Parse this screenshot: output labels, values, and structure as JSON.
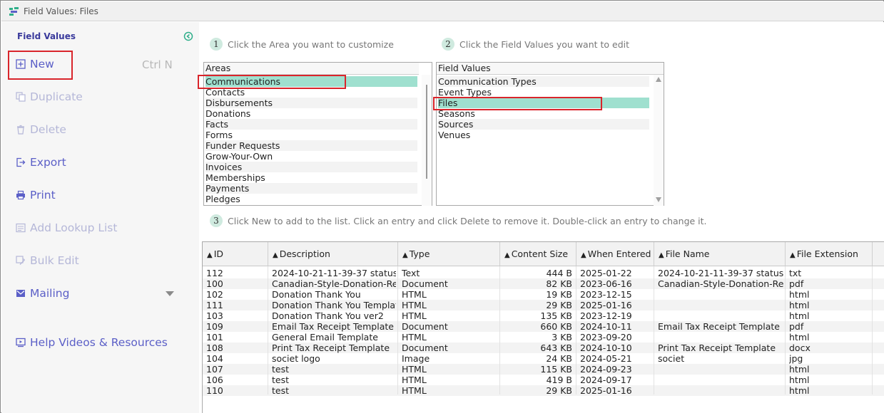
{
  "window": {
    "title": "Field Values: Files"
  },
  "sidebar": {
    "title": "Field Values",
    "new": {
      "label": "New",
      "shortcut": "Ctrl N"
    },
    "items": [
      {
        "label": "Duplicate",
        "enabled": false
      },
      {
        "label": "Delete",
        "enabled": false
      },
      {
        "label": "Export",
        "enabled": true
      },
      {
        "label": "Print",
        "enabled": true
      },
      {
        "label": "Add Lookup List",
        "enabled": false
      },
      {
        "label": "Bulk Edit",
        "enabled": false
      },
      {
        "label": "Mailing",
        "enabled": true
      }
    ],
    "help": {
      "label": "Help Videos & Resources"
    }
  },
  "steps": {
    "s1": {
      "num": "1",
      "text": "Click the Area you want to customize"
    },
    "s2": {
      "num": "2",
      "text": "Click the Field Values you want to edit"
    },
    "s3": {
      "num": "3",
      "text": "Click New to add to the list. Click an entry and click Delete to remove it. Double-click an entry to change it."
    }
  },
  "areas": {
    "header": "Areas",
    "selected": "Communications",
    "items": [
      "Communications",
      "Contacts",
      "Disbursements",
      "Donations",
      "Facts",
      "Forms",
      "Funder Requests",
      "Grow-Your-Own",
      "Invoices",
      "Memberships",
      "Payments",
      "Pledges"
    ]
  },
  "field_values": {
    "header": "Field Values",
    "selected": "Files",
    "items": [
      "Communication Types",
      "Event Types",
      "Files",
      "Seasons",
      "Sources",
      "Venues"
    ]
  },
  "table": {
    "columns": [
      "ID",
      "Description",
      "Type",
      "Content Size",
      "When Entered",
      "File Name",
      "File Extension"
    ],
    "rows": [
      [
        "112",
        "2024-10-21-11-39-37 status",
        "Text",
        "444 B",
        "2025-01-22",
        "2024-10-21-11-39-37 status",
        "txt"
      ],
      [
        "100",
        "Canadian-Style-Donation-Rec",
        "Document",
        "82 KB",
        "2023-06-16",
        "Canadian-Style-Donation-Rec",
        "pdf"
      ],
      [
        "102",
        "Donation Thank You",
        "HTML",
        "19 KB",
        "2023-12-15",
        "",
        "html"
      ],
      [
        "111",
        "Donation Thank You Template",
        "HTML",
        "29 KB",
        "2025-01-16",
        "",
        "html"
      ],
      [
        "103",
        "Donation Thank You ver2",
        "HTML",
        "135 KB",
        "2023-12-19",
        "",
        "html"
      ],
      [
        "109",
        "Email Tax Receipt Template",
        "Document",
        "660 KB",
        "2024-10-11",
        "Email Tax Receipt Template",
        "pdf"
      ],
      [
        "101",
        "General Email Template",
        "HTML",
        "3 KB",
        "2023-09-20",
        "",
        "html"
      ],
      [
        "108",
        "Print Tax Receipt Template",
        "Document",
        "643 KB",
        "2024-10-10",
        "Print Tax Receipt Template",
        "docx"
      ],
      [
        "104",
        "societ logo",
        "Image",
        "24 KB",
        "2024-05-21",
        "societ",
        "jpg"
      ],
      [
        "107",
        "test",
        "HTML",
        "115 KB",
        "2024-09-23",
        "",
        "html"
      ],
      [
        "106",
        "test",
        "HTML",
        "419 B",
        "2024-09-17",
        "",
        "html"
      ],
      [
        "110",
        "test",
        "HTML",
        "29 KB",
        "2025-01-16",
        "",
        "html"
      ]
    ]
  },
  "colors": {
    "accent": "#5b5fc7",
    "selection": "#9fe0cf",
    "highlight": "#d9252b"
  }
}
